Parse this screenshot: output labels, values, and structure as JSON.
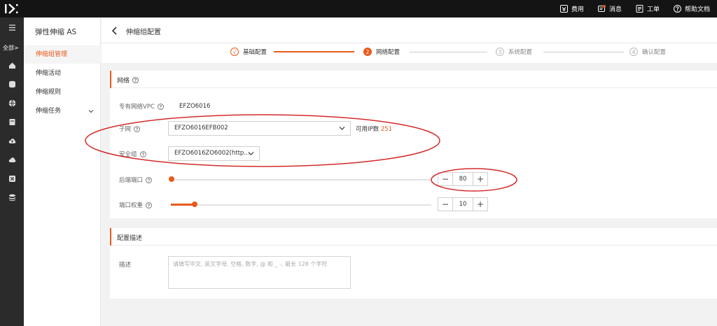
{
  "topbar": {
    "items": [
      {
        "label": "费用",
        "icon": "cost-icon"
      },
      {
        "label": "消息",
        "icon": "message-icon"
      },
      {
        "label": "工单",
        "icon": "ticket-icon"
      },
      {
        "label": "帮助文档",
        "icon": "help-doc-icon"
      }
    ]
  },
  "rail": {
    "all_label": "全部>"
  },
  "subnav": {
    "title": "弹性伸缩 AS",
    "items": [
      {
        "label": "伸缩组管理"
      },
      {
        "label": "伸缩活动"
      },
      {
        "label": "伸缩规则"
      },
      {
        "label": "伸缩任务"
      }
    ]
  },
  "header": {
    "title": "伸缩组配置"
  },
  "steps": [
    {
      "num": "√",
      "label": "基础配置",
      "state": "done"
    },
    {
      "num": "2",
      "label": "网络配置",
      "state": "active"
    },
    {
      "num": "3",
      "label": "系统配置",
      "state": "todo"
    },
    {
      "num": "4",
      "label": "确认配置",
      "state": "todo"
    }
  ],
  "network": {
    "title": "网络",
    "vpc_label": "专有网络VPC",
    "vpc_value": "EFZO6016",
    "subnet_label": "子网",
    "subnet_value": "EFZO6016EFB002",
    "ip_label": "可用IP数",
    "ip_count": "251",
    "sg_label": "安全组",
    "sg_value": "EFZO6016ZO6002(http...",
    "port_label": "后端端口",
    "port_value": "80",
    "weight_label": "端口权重",
    "weight_value": "10"
  },
  "desc": {
    "title": "配置描述",
    "label": "描述",
    "placeholder": "请填写中文, 英文字母, 空格, 数字, @ 和 _ -, 最长 128 个字符"
  },
  "colors": {
    "accent": "#e85a1c",
    "annotation": "#d42a2a"
  }
}
